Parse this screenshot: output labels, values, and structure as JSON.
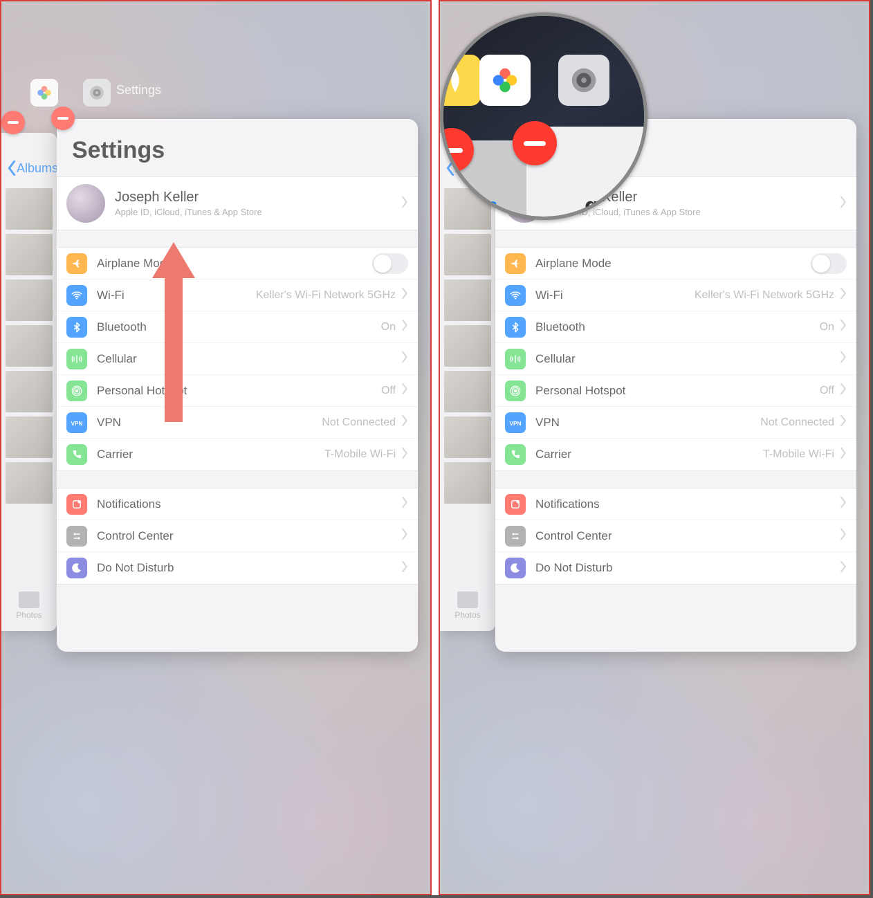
{
  "app": {
    "switcher_label": "Settings",
    "photos_back_label": "Albums",
    "photos_tab_label": "Photos",
    "photos_icon": "photos-icon",
    "settings_icon": "settings-gear-icon"
  },
  "settings": {
    "title": "Settings",
    "profile": {
      "name": "Joseph Keller",
      "subtitle": "Apple ID, iCloud, iTunes & App Store"
    },
    "rows_group1": [
      {
        "icon": "airplane",
        "icon_color": "#ff9500",
        "label": "Airplane Mode",
        "value": "",
        "type": "toggle"
      },
      {
        "icon": "wifi",
        "icon_color": "#007aff",
        "label": "Wi-Fi",
        "value": "Keller's Wi-Fi Network 5GHz",
        "type": "link"
      },
      {
        "icon": "bluetooth",
        "icon_color": "#007aff",
        "label": "Bluetooth",
        "value": "On",
        "type": "link"
      },
      {
        "icon": "cellular",
        "icon_color": "#4cd964",
        "label": "Cellular",
        "value": "",
        "type": "link"
      },
      {
        "icon": "hotspot",
        "icon_color": "#4cd964",
        "label": "Personal Hotspot",
        "value": "Off",
        "type": "link"
      },
      {
        "icon": "vpn",
        "icon_color": "#007aff",
        "label": "VPN",
        "value": "Not Connected",
        "type": "link"
      },
      {
        "icon": "carrier",
        "icon_color": "#4cd964",
        "label": "Carrier",
        "value": "T-Mobile Wi-Fi",
        "type": "link"
      }
    ],
    "rows_group2": [
      {
        "icon": "notifications",
        "icon_color": "#ff3b30",
        "label": "Notifications",
        "value": "",
        "type": "link"
      },
      {
        "icon": "control",
        "icon_color": "#8e8e93",
        "label": "Control Center",
        "value": "",
        "type": "link"
      },
      {
        "icon": "dnd",
        "icon_color": "#5856d6",
        "label": "Do Not Disturb",
        "value": "",
        "type": "link"
      }
    ]
  },
  "magnifier": {
    "albums_fragment": "bums",
    "gs_fragment": "gs"
  }
}
